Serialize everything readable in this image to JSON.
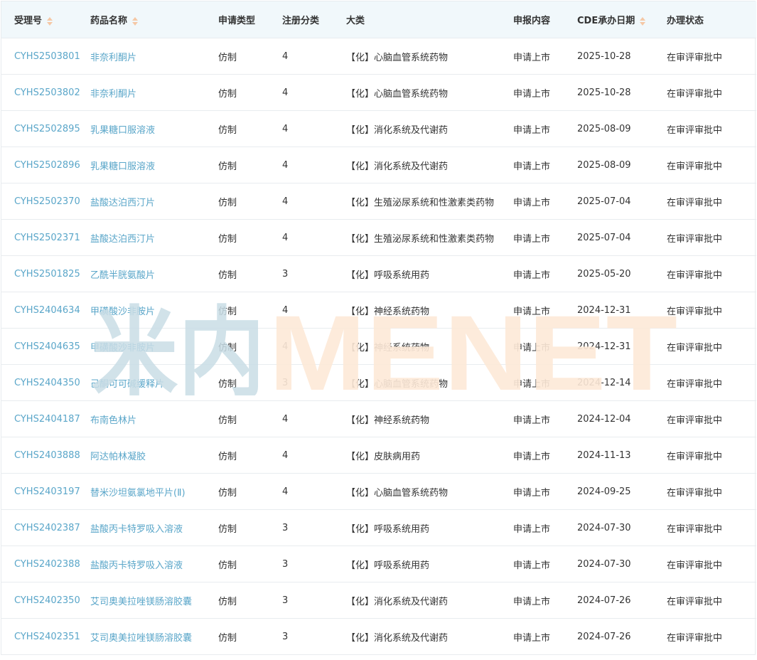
{
  "columns": [
    {
      "label": "受理号",
      "sortable": true
    },
    {
      "label": "药品名称",
      "sortable": true
    },
    {
      "label": "申请类型",
      "sortable": false
    },
    {
      "label": "注册分类",
      "sortable": false
    },
    {
      "label": "大类",
      "sortable": false
    },
    {
      "label": "申报内容",
      "sortable": false
    },
    {
      "label": "CDE承办日期",
      "sortable": true
    },
    {
      "label": "办理状态",
      "sortable": false
    }
  ],
  "rows": [
    {
      "id": "CYHS2503801",
      "name": "非奈利酮片",
      "type": "仿制",
      "category": "4",
      "class": "【化】心脑血管系统药物",
      "content": "申请上市",
      "date": "2025-10-28",
      "status": "在审评审批中"
    },
    {
      "id": "CYHS2503802",
      "name": "非奈利酮片",
      "type": "仿制",
      "category": "4",
      "class": "【化】心脑血管系统药物",
      "content": "申请上市",
      "date": "2025-10-28",
      "status": "在审评审批中"
    },
    {
      "id": "CYHS2502895",
      "name": "乳果糖口服溶液",
      "type": "仿制",
      "category": "4",
      "class": "【化】消化系统及代谢药",
      "content": "申请上市",
      "date": "2025-08-09",
      "status": "在审评审批中"
    },
    {
      "id": "CYHS2502896",
      "name": "乳果糖口服溶液",
      "type": "仿制",
      "category": "4",
      "class": "【化】消化系统及代谢药",
      "content": "申请上市",
      "date": "2025-08-09",
      "status": "在审评审批中"
    },
    {
      "id": "CYHS2502370",
      "name": "盐酸达泊西汀片",
      "type": "仿制",
      "category": "4",
      "class": "【化】生殖泌尿系统和性激素类药物",
      "content": "申请上市",
      "date": "2025-07-04",
      "status": "在审评审批中"
    },
    {
      "id": "CYHS2502371",
      "name": "盐酸达泊西汀片",
      "type": "仿制",
      "category": "4",
      "class": "【化】生殖泌尿系统和性激素类药物",
      "content": "申请上市",
      "date": "2025-07-04",
      "status": "在审评审批中"
    },
    {
      "id": "CYHS2501825",
      "name": "乙酰半胱氨酸片",
      "type": "仿制",
      "category": "3",
      "class": "【化】呼吸系统用药",
      "content": "申请上市",
      "date": "2025-05-20",
      "status": "在审评审批中"
    },
    {
      "id": "CYHS2404634",
      "name": "甲磺酸沙非胺片",
      "type": "仿制",
      "category": "4",
      "class": "【化】神经系统药物",
      "content": "申请上市",
      "date": "2024-12-31",
      "status": "在审评审批中"
    },
    {
      "id": "CYHS2404635",
      "name": "甲磺酸沙非胺片",
      "type": "仿制",
      "category": "4",
      "class": "【化】神经系统药物",
      "content": "申请上市",
      "date": "2024-12-31",
      "status": "在审评审批中"
    },
    {
      "id": "CYHS2404350",
      "name": "己酮可可碱缓释片",
      "type": "仿制",
      "category": "3",
      "class": "【化】心脑血管系统药物",
      "content": "申请上市",
      "date": "2024-12-14",
      "status": "在审评审批中"
    },
    {
      "id": "CYHS2404187",
      "name": "布南色林片",
      "type": "仿制",
      "category": "4",
      "class": "【化】神经系统药物",
      "content": "申请上市",
      "date": "2024-12-04",
      "status": "在审评审批中"
    },
    {
      "id": "CYHS2403888",
      "name": "阿达帕林凝胶",
      "type": "仿制",
      "category": "4",
      "class": "【化】皮肤病用药",
      "content": "申请上市",
      "date": "2024-11-13",
      "status": "在审评审批中"
    },
    {
      "id": "CYHS2403197",
      "name": "替米沙坦氨氯地平片(Ⅱ)",
      "type": "仿制",
      "category": "4",
      "class": "【化】心脑血管系统药物",
      "content": "申请上市",
      "date": "2024-09-25",
      "status": "在审评审批中"
    },
    {
      "id": "CYHS2402387",
      "name": "盐酸丙卡特罗吸入溶液",
      "type": "仿制",
      "category": "3",
      "class": "【化】呼吸系统用药",
      "content": "申请上市",
      "date": "2024-07-30",
      "status": "在审评审批中"
    },
    {
      "id": "CYHS2402388",
      "name": "盐酸丙卡特罗吸入溶液",
      "type": "仿制",
      "category": "3",
      "class": "【化】呼吸系统用药",
      "content": "申请上市",
      "date": "2024-07-30",
      "status": "在审评审批中"
    },
    {
      "id": "CYHS2402350",
      "name": "艾司奥美拉唑镁肠溶胶囊",
      "type": "仿制",
      "category": "3",
      "class": "【化】消化系统及代谢药",
      "content": "申请上市",
      "date": "2024-07-26",
      "status": "在审评审批中"
    },
    {
      "id": "CYHS2402351",
      "name": "艾司奥美拉唑镁肠溶胶囊",
      "type": "仿制",
      "category": "3",
      "class": "【化】消化系统及代谢药",
      "content": "申请上市",
      "date": "2024-07-26",
      "status": "在审评审批中"
    }
  ],
  "watermark": {
    "cn": "米内",
    "en": "MENET"
  },
  "colors": {
    "link": "#5aa6c9",
    "header_bg": "#f1f8fb",
    "border": "#e8ecef",
    "sort_icon": "#f5c8a6",
    "watermark_blue": "#c9dde6",
    "watermark_orange": "#fde9d8"
  },
  "icons": {
    "sort": "sort-caret-icon"
  }
}
